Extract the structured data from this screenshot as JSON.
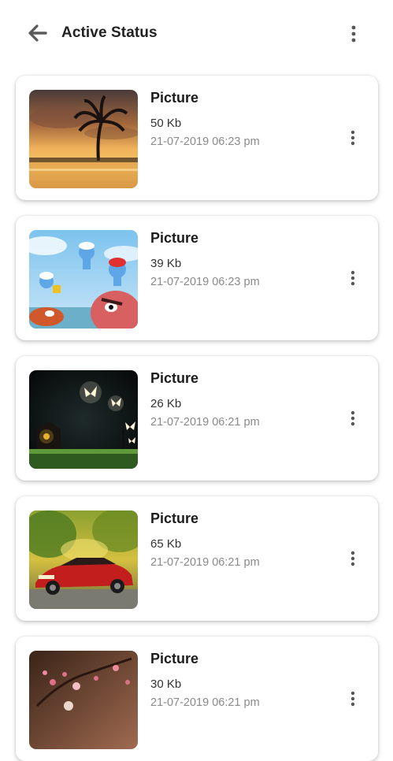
{
  "header": {
    "title": "Active Status",
    "back_icon": "arrow-left-icon",
    "overflow_icon": "more-vert-icon"
  },
  "items": [
    {
      "title": "Picture",
      "size": "50 Kb",
      "date": "21-07-2019 06:23 pm",
      "thumbnail": "palm-tree-sunset"
    },
    {
      "title": "Picture",
      "size": "39 Kb",
      "date": "21-07-2019 06:23 pm",
      "thumbnail": "cartoon-characters"
    },
    {
      "title": "Picture",
      "size": "26 Kb",
      "date": "21-07-2019 06:21 pm",
      "thumbnail": "glowing-butterflies-night"
    },
    {
      "title": "Picture",
      "size": "65 Kb",
      "date": "21-07-2019 06:21 pm",
      "thumbnail": "red-sports-car"
    },
    {
      "title": "Picture",
      "size": "30 Kb",
      "date": "21-07-2019 06:21 pm",
      "thumbnail": "blossom-branch"
    }
  ],
  "colors": {
    "background": "#ffffff",
    "title_text": "#222222",
    "secondary_text": "#8a8a8a",
    "icon": "#555555"
  }
}
